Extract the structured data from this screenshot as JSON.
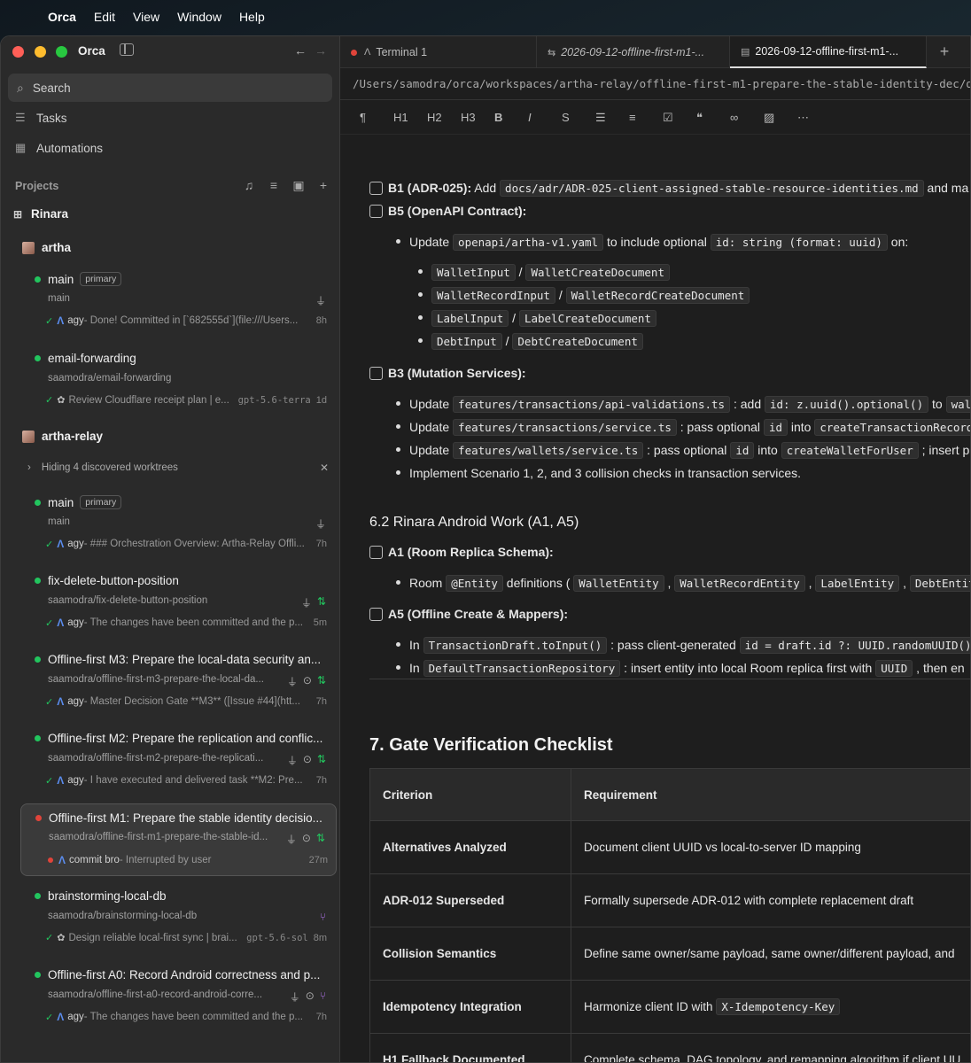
{
  "menubar": {
    "app": "Orca",
    "items": [
      "Edit",
      "View",
      "Window",
      "Help"
    ]
  },
  "sidebar": {
    "window_title": "Orca",
    "search_label": "Search",
    "nav": [
      {
        "label": "Tasks",
        "icon": "tasks-icon"
      },
      {
        "label": "Automations",
        "icon": "automations-icon"
      }
    ],
    "projects_label": "Projects",
    "group": "Rinara",
    "projects": [
      {
        "name": "artha"
      },
      {
        "name": "artha-relay",
        "hiding": "Hiding 4 discovered worktrees"
      }
    ],
    "worktrees": [
      {
        "title": "main",
        "badge": "primary",
        "branch": "main",
        "agent": "agy",
        "msg": "- Done! Committed in [`682555d`](file:///Users...",
        "age": "8h"
      },
      {
        "title": "email-forwarding",
        "branch": "saamodra/email-forwarding",
        "msg": "Review Cloudflare receipt plan | e...",
        "model": "gpt-5.6-terra",
        "age": "1d"
      },
      {
        "title": "main",
        "badge": "primary",
        "branch": "main",
        "agent": "agy",
        "msg": "- ### Orchestration Overview: Artha-Relay Offli...",
        "age": "7h"
      },
      {
        "title": "fix-delete-button-position",
        "branch": "saamodra/fix-delete-button-position",
        "agent": "agy",
        "msg": "- The changes have been committed and the p...",
        "age": "5m"
      },
      {
        "title": "Offline-first M3: Prepare the local-data security an...",
        "branch": "saamodra/offline-first-m3-prepare-the-local-da...",
        "agent": "agy",
        "msg": "- Master Decision Gate **M3** ([Issue #44](htt...",
        "age": "7h"
      },
      {
        "title": "Offline-first M2: Prepare the replication and conflic...",
        "branch": "saamodra/offline-first-m2-prepare-the-replicati...",
        "agent": "agy",
        "msg": "- I have executed and delivered task **M2: Pre...",
        "age": "7h"
      },
      {
        "title": "Offline-first M1: Prepare the stable identity decisio...",
        "branch": "saamodra/offline-first-m1-prepare-the-stable-id...",
        "agent": "commit bro",
        "msg": "- Interrupted by user",
        "age": "27m"
      },
      {
        "title": "brainstorming-local-db",
        "branch": "saamodra/brainstorming-local-db",
        "msg": "Design reliable local-first sync | brai...",
        "model": "gpt-5.6-sol",
        "age": "8m"
      },
      {
        "title": "Offline-first A0: Record Android correctness and p...",
        "branch": "saamodra/offline-first-a0-record-android-corre...",
        "agent": "agy",
        "msg": "- The changes have been committed and the p...",
        "age": "7h"
      }
    ]
  },
  "tabs": [
    {
      "label": "Terminal 1"
    },
    {
      "label": "2026-09-12-offline-first-m1-..."
    },
    {
      "label": "2026-09-12-offline-first-m1-..."
    }
  ],
  "path": "/Users/samodra/orca/workspaces/artha-relay/offline-first-m1-prepare-the-stable-identity-dec/docs",
  "toolbar": [
    "¶",
    "H1",
    "H2",
    "H3",
    "B",
    "I",
    "S",
    "bullets",
    "numbers",
    "tasks",
    "quote",
    "link",
    "image",
    "more"
  ],
  "doc": {
    "b1_bold": "B1 (ADR-025):",
    "b1_text": " Add ",
    "b1_code": "docs/adr/ADR-025-client-assigned-stable-resource-identities.md",
    "b1_tail": " and ma",
    "b5": "B5 (OpenAPI Contract):",
    "b5_l1a": "Update ",
    "b5_l1c": "openapi/artha-v1.yaml",
    "b5_l1b": " to include optional ",
    "b5_l1d": "id: string (format: uuid)",
    "b5_l1e": " on:",
    "pairs": [
      [
        "WalletInput",
        "WalletCreateDocument"
      ],
      [
        "WalletRecordInput",
        "WalletRecordCreateDocument"
      ],
      [
        "LabelInput",
        "LabelCreateDocument"
      ],
      [
        "DebtInput",
        "DebtCreateDocument"
      ]
    ],
    "b3": "B3 (Mutation Services):",
    "b3_1a": "Update ",
    "b3_1c": "features/transactions/api-validations.ts",
    "b3_1b": " : add ",
    "b3_1d": "id: z.uuid().optional()",
    "b3_1e": " to ",
    "b3_1f": "wall",
    "b3_2a": "Update ",
    "b3_2c": "features/transactions/service.ts",
    "b3_2b": " : pass optional ",
    "b3_2d": "id",
    "b3_2e": " into ",
    "b3_2f": "createTransactionRecord",
    "b3_3a": "Update ",
    "b3_3c": "features/wallets/service.ts",
    "b3_3b": " : pass optional ",
    "b3_3d": "id",
    "b3_3e": " into ",
    "b3_3f": "createWalletForUser",
    "b3_3g": " ; insert pr",
    "b3_4": "Implement Scenario 1, 2, and 3 collision checks in transaction services.",
    "h62": "6.2 Rinara Android Work (A1, A5)",
    "a1": "A1 (Room Replica Schema):",
    "a1_1a": "Room ",
    "a1_1c": "@Entity",
    "a1_1b": " definitions ( ",
    "ents": [
      "WalletEntity",
      "WalletRecordEntity",
      "LabelEntity",
      "DebtEntity"
    ],
    "a1_1e": " )",
    "a5": "A5 (Offline Create & Mappers):",
    "a5_1a": "In ",
    "a5_1c": "TransactionDraft.toInput()",
    "a5_1b": " : pass client-generated ",
    "a5_1d": "id = draft.id ?: UUID.randomUUID()",
    "a5_2a": "In ",
    "a5_2c": "DefaultTransactionRepository",
    "a5_2b": " : insert entity into local Room replica first with ",
    "a5_2d": "UUID",
    "a5_2e": " , then en",
    "h7": "7. Gate Verification Checklist",
    "table_head": [
      "Criterion",
      "Requirement"
    ],
    "rows": [
      [
        "Alternatives Analyzed",
        "Document client UUID vs local-to-server ID mapping",
        ""
      ],
      [
        "ADR-012 Superseded",
        "Formally supersede ADR-012 with complete replacement draft",
        ""
      ],
      [
        "Collision Semantics",
        "Define same owner/same payload, same owner/different payload, and",
        ""
      ],
      [
        "Idempotency Integration",
        "Harmonize client ID with ",
        "X-Idempotency-Key"
      ],
      [
        "H1 Fallback Documented",
        "Complete schema, DAG topology, and remapping algorithm if client UU",
        ""
      ]
    ]
  }
}
